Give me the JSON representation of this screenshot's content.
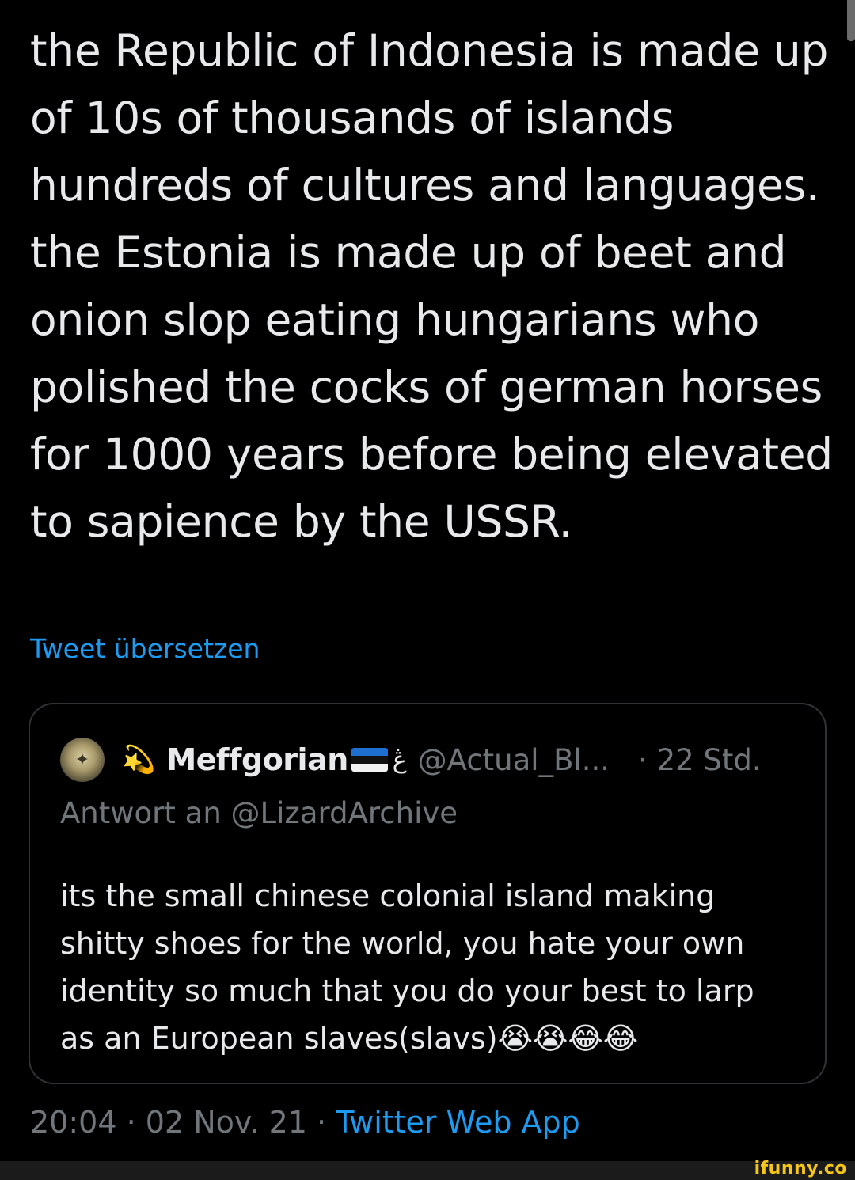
{
  "tweet": {
    "text": "the Republic of Indonesia is made up of 10s of thousands of islands hundreds of cultures and languages. the Estonia is made up of beet and onion slop eating hungarians who polished the cocks of german horses for 1000 years before being elevated to sapience by the USSR.",
    "translate_label": "Tweet übersetzen",
    "time": "20:04",
    "date": "02 Nov. 21",
    "source": "Twitter Web App",
    "separator": " · "
  },
  "quote": {
    "display_name": "Meffgorian",
    "name_glyph": "ڠ",
    "handle": "@Actual_Bl...",
    "time_ago": "· 22 Std.",
    "reply_to": "Antwort an @LizardArchive",
    "text": "its the small chinese colonial island making shitty shoes for the world, you hate your own identity so much that you do your best to larp as an European slaves(slavs)",
    "emojis": "😭😭😂😂",
    "deco_emoji": "💫"
  },
  "watermark": "ifunny.co",
  "colors": {
    "background": "#000000",
    "text": "#e7e9ea",
    "muted": "#71767b",
    "link": "#1d9bf0",
    "border": "#2f3336",
    "watermark": "#f5c518"
  }
}
